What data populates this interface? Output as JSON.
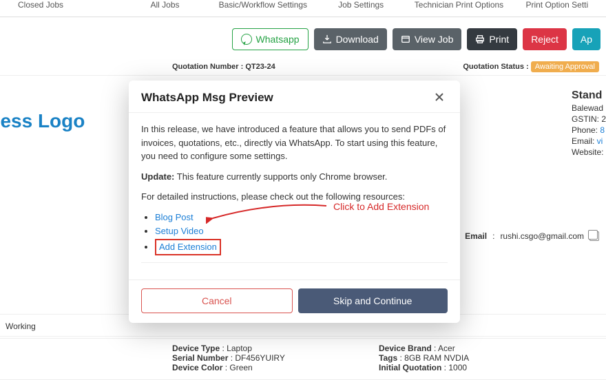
{
  "tabs": {
    "closed": "Closed Jobs",
    "all": "All Jobs",
    "workflow": "Basic/Workflow Settings",
    "job": "Job Settings",
    "techprint": "Technician Print Options",
    "printopt": "Print Option Setti"
  },
  "actions": {
    "whatsapp": "Whatsapp",
    "download": "Download",
    "view": "View Job",
    "print": "Print",
    "reject": "Reject",
    "approve": "Ap"
  },
  "quote": {
    "number_label": "Quotation Number :",
    "number_value": "QT23-24",
    "status_label": "Quotation Status :",
    "status_value": "Awaiting Approval"
  },
  "logo_text": "siness Logo",
  "company": {
    "name": "Stand",
    "line1": "Balewad",
    "gstin": "GSTIN: 2",
    "phone_label": "Phone:",
    "phone_value": "8",
    "email_label": "Email:",
    "email_value": "vi",
    "website_label": "Website:"
  },
  "customer": {
    "email_label": "Email",
    "email_value": "rushi.csgo@gmail.com"
  },
  "device": {
    "type_label": "Device Type",
    "type_value": "Laptop",
    "serial_label": "Serial Number",
    "serial_value": "DF456YUIRY",
    "color_label": "Device Color",
    "color_value": "Green",
    "brand_label": "Device Brand",
    "brand_value": "Acer",
    "tags_label": "Tags",
    "tags_value": "8GB RAM NVDIA",
    "quote_label": "Initial Quotation",
    "quote_value": "1000"
  },
  "footer": {
    "working": "Working"
  },
  "modal": {
    "title": "WhatsApp Msg Preview",
    "intro": "In this release, we have introduced a feature that allows you to send PDFs of invoices, quotations, etc., directly via WhatsApp. To start using this feature, you need to configure some settings.",
    "update_label": "Update:",
    "update_text": " This feature currently supports only Chrome browser.",
    "instructions": "For detailed instructions, please check out the following resources:",
    "links": {
      "blog": "Blog Post",
      "video": "Setup Video",
      "ext": "Add Extension"
    },
    "cancel": "Cancel",
    "skip": "Skip and Continue"
  },
  "annotation": "Click to Add Extension"
}
